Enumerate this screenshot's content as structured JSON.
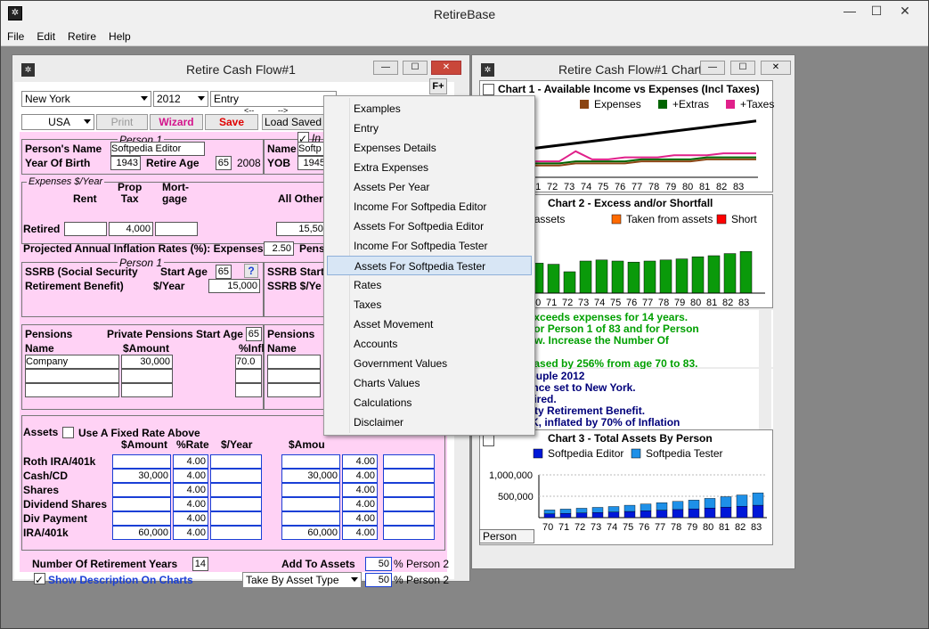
{
  "app": {
    "title": "RetireBase",
    "icon": "app-icon"
  },
  "menu": [
    "File",
    "Edit",
    "Retire",
    "Help"
  ],
  "controls": {
    "minimize": "—",
    "maximize": "☐",
    "close": "✕"
  },
  "cashflow": {
    "title": "Retire Cash Flow#1",
    "state": "New York",
    "year": "2012",
    "view": "Entry",
    "fplus": "F+",
    "country": "USA",
    "print": "Print",
    "wizard": "Wizard",
    "save": "Save",
    "load": "Load Saved",
    "arrows": {
      "left": "<--",
      "right": "-->"
    },
    "person1_label": "Person 1",
    "persons_name_label": "Person's Name",
    "persons_name": "Softpedia Editor",
    "year_of_birth_label": "Year Of Birth",
    "year_of_birth": "1943",
    "retire_age_label": "Retire Age",
    "retire_age": "65",
    "retire_year": "2008",
    "name_label": "Name",
    "name2": "Softp",
    "yob_label": "YOB",
    "yob2": "1945",
    "in_label": "In",
    "expenses_label": "Expenses $/Year",
    "col_rent": "Rent",
    "col_prop_tax": "Prop\nTax",
    "col_mortgage": "Mort-\ngage",
    "col_all_other": "All Other",
    "retired_label": "Retired",
    "prop_tax_value": "4,000",
    "all_other_value": "15,500",
    "inflation_label": "Projected Annual Inflation Rates (%):  Expenses",
    "inflation_value": "2.50",
    "pensi_label": "Pensi",
    "ssrb_label": "SSRB (Social Security",
    "start_age_label": "Start Age",
    "start_age": "65",
    "help": "?",
    "retirement_benefit_label": "Retirement Benefit)",
    "per_year_label": "$/Year",
    "ssrb_value": "15,000",
    "ssrb_start_label": "SSRB Start",
    "ssrb_per_year_label": "SSRB $/Ye",
    "pensions_label": "Pensions",
    "private_pensions_label": "Private Pensions Start Age",
    "private_start_age": "65",
    "pname_label": "Name",
    "pamount_label": "$Amount",
    "pinfl_label": "%Infl",
    "pension_name": "Company",
    "pension_amount": "30,000",
    "pension_infl": "70.0",
    "pensions2_label": "Pensions",
    "pname2_label": "Name",
    "assets_label": "Assets",
    "fixed_rate_label": "Use A Fixed Rate Above",
    "amount_label": "$Amount",
    "rate_label": "%Rate",
    "per_year2_label": "$/Year",
    "amount2_label": "$Amou",
    "assets": [
      {
        "name": "Roth IRA/401k",
        "amount": "",
        "rate": "4.00",
        "amount2": "",
        "rate2": "4.00"
      },
      {
        "name": "Cash/CD",
        "amount": "30,000",
        "rate": "4.00",
        "amount2": "30,000",
        "rate2": "4.00"
      },
      {
        "name": "Shares",
        "amount": "",
        "rate": "4.00",
        "amount2": "",
        "rate2": "4.00"
      },
      {
        "name": "Dividend Shares",
        "amount": "",
        "rate": "4.00",
        "amount2": "",
        "rate2": "4.00"
      },
      {
        "name": "Div Payment",
        "amount": "",
        "rate": "4.00",
        "amount2": "",
        "rate2": "4.00"
      },
      {
        "name": "IRA/401k",
        "amount": "60,000",
        "rate": "4.00",
        "amount2": "60,000",
        "rate2": "4.00"
      }
    ],
    "num_years_label": "Number Of Retirement Years",
    "num_years": "14",
    "add_to_assets_label": "Add To Assets",
    "add_pct": "50",
    "pct_person2": "% Person 2",
    "show_desc_label": "Show Description On Charts",
    "take_by_label": "Take By Asset Type",
    "take_pct": "50",
    "pct_person2b": "% Person 2"
  },
  "charts": {
    "title": "Retire Cash Flow#1 Charts",
    "chart1_title": "Chart 1 - Available Income vs Expenses (Incl Taxes)",
    "chart1_legend": [
      "ncome",
      "Expenses",
      "+Extras",
      "+Taxes"
    ],
    "chart1_colors": [
      "#000000",
      "#8b4513",
      "#006400",
      "#e0208a"
    ],
    "chart2_title": "Chart 2 - Excess and/or Shortfall",
    "chart2_legend": [
      "ded to assets",
      "Taken from assets",
      "Short"
    ],
    "chart2_colors": [
      "#00a000",
      "#ff6a00",
      "#ff0000"
    ],
    "years": [
      "70",
      "71",
      "72",
      "73",
      "74",
      "75",
      "76",
      "77",
      "78",
      "79",
      "80",
      "81",
      "82",
      "83"
    ],
    "msg1": [
      ": Income exceeds expenses for 14 years.",
      "pectancy for Person 1 of 83 and for Person",
      "y be too low. Increase the Number Of",
      "t Years.",
      "have increased by 256% from age 70 to 83."
    ],
    "msg2": [
      "SA 60's Couple 2012",
      ": 65. Province set to New York.",
      "of 53K Retired.",
      "cial Security Retirement Benefit.",
      "sion of 30K, inflated by 70% of Inflation"
    ],
    "chart3_title": "Chart 3 - Total Assets By Person",
    "chart3_legend": [
      "Softpedia Editor",
      "Softpedia Tester"
    ],
    "chart3_colors": [
      "#0018d8",
      "#1e90e8"
    ],
    "chart3_ticks": [
      "1,000,000",
      "500,000"
    ],
    "person_tab": "Person"
  },
  "chart_data": [
    {
      "type": "line",
      "title": "Chart 1 - Available Income vs Expenses (Incl Taxes)",
      "series": [
        {
          "name": "ncome",
          "values": [
            63,
            64,
            65,
            66,
            67,
            68,
            69,
            70,
            71,
            72,
            73,
            74,
            75,
            76,
            77
          ]
        },
        {
          "name": "Expenses",
          "values": [
            55,
            55,
            55,
            56,
            56,
            56,
            56,
            57,
            57,
            57,
            57,
            58,
            58,
            58,
            58
          ]
        },
        {
          "name": "+Extras",
          "values": [
            56,
            56,
            56,
            57,
            57,
            57,
            57,
            58,
            58,
            58,
            58,
            59,
            59,
            59,
            59
          ]
        },
        {
          "name": "+Taxes",
          "values": [
            57,
            57,
            57,
            62,
            58,
            58,
            59,
            59,
            59,
            60,
            60,
            60,
            61,
            61,
            61
          ]
        }
      ]
    },
    {
      "type": "bar",
      "title": "Chart 2 - Excess and/or Shortfall",
      "categories": [
        "69",
        "70",
        "71",
        "72",
        "73",
        "74",
        "75",
        "76",
        "77",
        "78",
        "79",
        "80",
        "81",
        "82",
        "83"
      ],
      "values": [
        28,
        28,
        27,
        20,
        30,
        31,
        30,
        29,
        30,
        31,
        32,
        34,
        35,
        37,
        39
      ]
    },
    {
      "type": "bar",
      "title": "Chart 3 - Total Assets By Person",
      "categories": [
        "70",
        "71",
        "72",
        "73",
        "74",
        "75",
        "76",
        "77",
        "78",
        "79",
        "80",
        "81",
        "82",
        "83"
      ],
      "ylim": [
        0,
        1000000
      ],
      "series": [
        {
          "name": "Softpedia Editor",
          "values": [
            90000,
            100000,
            110000,
            120000,
            130000,
            145000,
            160000,
            175000,
            190000,
            205000,
            225000,
            245000,
            265000,
            290000
          ]
        },
        {
          "name": "Softpedia Tester",
          "values": [
            90000,
            100000,
            110000,
            120000,
            130000,
            145000,
            160000,
            175000,
            190000,
            205000,
            225000,
            245000,
            265000,
            290000
          ]
        }
      ]
    }
  ],
  "popup_menu": {
    "items": [
      "Examples",
      "Entry",
      "Expenses Details",
      "Extra Expenses",
      "Assets Per Year",
      "Income For Softpedia Editor",
      "Assets For Softpedia Editor",
      "Income For Softpedia Tester",
      "Assets For Softpedia Tester",
      "Rates",
      "Taxes",
      "Asset Movement",
      "Accounts",
      "Government Values",
      "Charts Values",
      "Calculations",
      "Disclaimer"
    ],
    "selected": 8
  }
}
